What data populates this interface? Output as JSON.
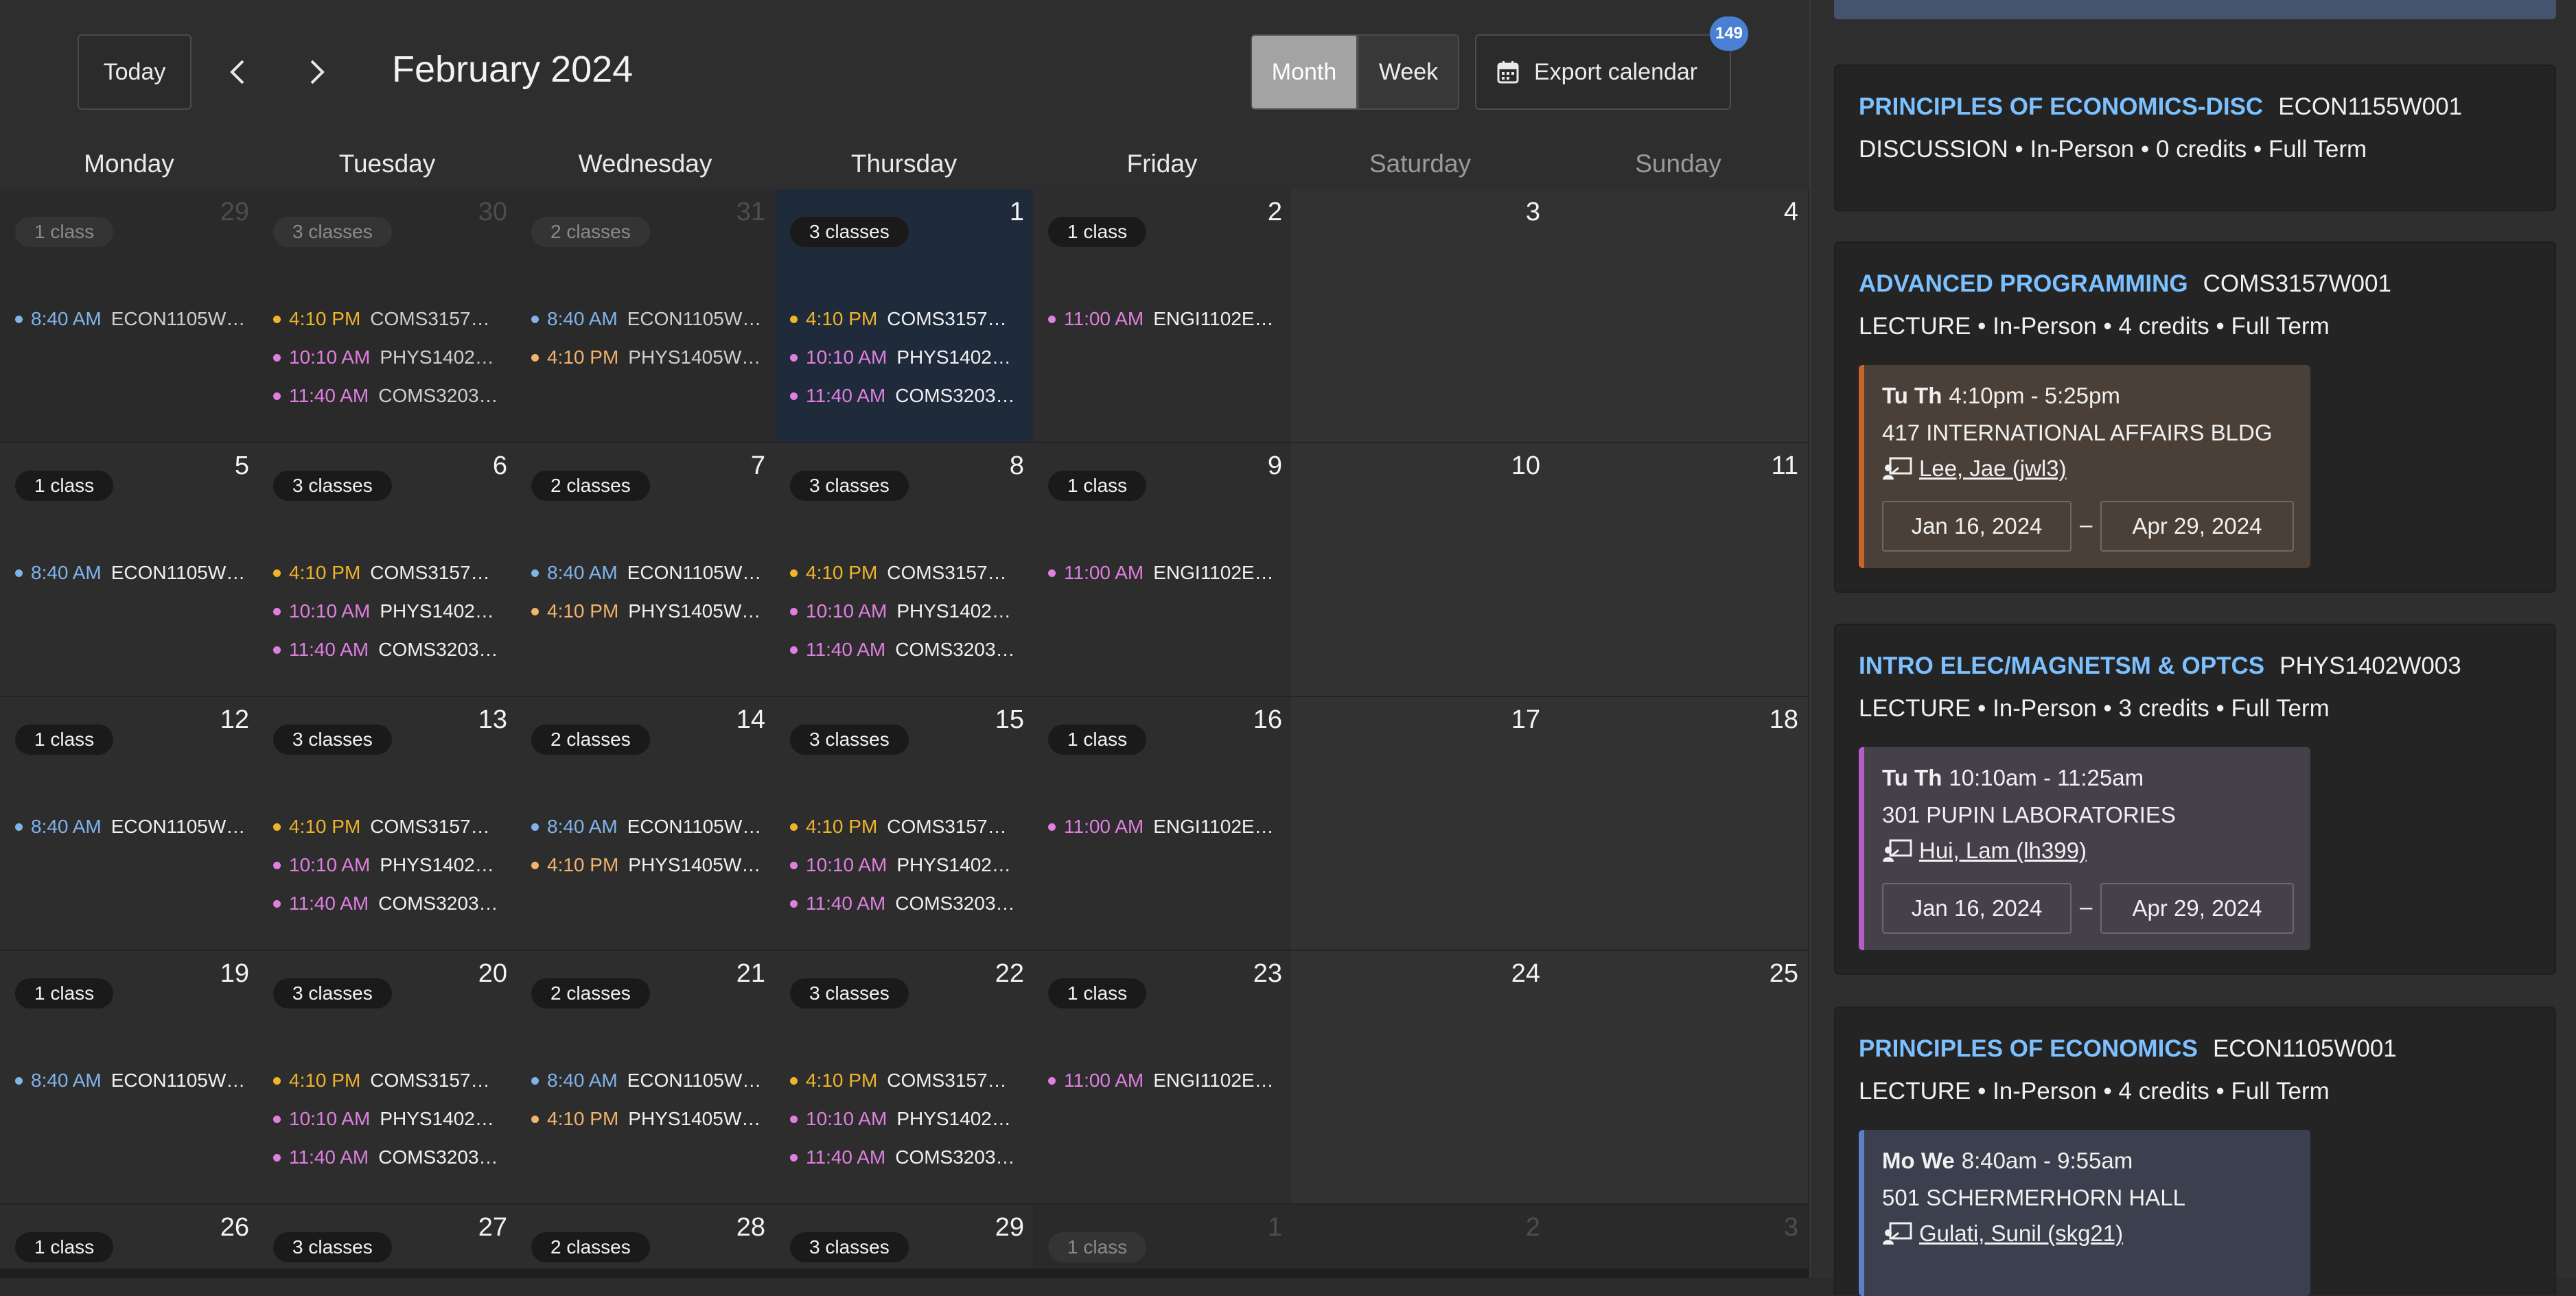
{
  "toolbar": {
    "today_label": "Today",
    "month_title": "February 2024",
    "month_label": "Month",
    "week_label": "Week",
    "export_label": "Export calendar",
    "badge_count": "149"
  },
  "weekdays": [
    "Monday",
    "Tuesday",
    "Wednesday",
    "Thursday",
    "Friday",
    "Saturday",
    "Sunday"
  ],
  "calendar": {
    "weeks": [
      [
        {
          "day": "29",
          "out": true,
          "pill": "1 class",
          "events": [
            {
              "time": "8:40 AM",
              "code": "ECON1105W…",
              "color": "#7fb3ea"
            }
          ]
        },
        {
          "day": "30",
          "out": true,
          "pill": "3 classes",
          "events": [
            {
              "time": "4:10 PM",
              "code": "COMS3157…",
              "color": "#f0b429"
            },
            {
              "time": "10:10 AM",
              "code": "PHYS1402…",
              "color": "#e07fe0"
            },
            {
              "time": "11:40 AM",
              "code": "COMS3203…",
              "color": "#e07fe0"
            }
          ]
        },
        {
          "day": "31",
          "out": true,
          "pill": "2 classes",
          "events": [
            {
              "time": "8:40 AM",
              "code": "ECON1105W…",
              "color": "#7fb3ea"
            },
            {
              "time": "4:10 PM",
              "code": "PHYS1405W…",
              "color": "#f2b36b"
            }
          ]
        },
        {
          "day": "1",
          "today": true,
          "pill": "3 classes",
          "events": [
            {
              "time": "4:10 PM",
              "code": "COMS3157…",
              "color": "#f0b429"
            },
            {
              "time": "10:10 AM",
              "code": "PHYS1402…",
              "color": "#e07fe0"
            },
            {
              "time": "11:40 AM",
              "code": "COMS3203…",
              "color": "#e07fe0"
            }
          ]
        },
        {
          "day": "2",
          "pill": "1 class",
          "events": [
            {
              "time": "11:00 AM",
              "code": "ENGI1102E…",
              "color": "#e07fe0"
            }
          ]
        },
        {
          "day": "3",
          "weekend": true,
          "events": []
        },
        {
          "day": "4",
          "weekend": true,
          "events": []
        }
      ],
      [
        {
          "day": "5",
          "pill": "1 class",
          "events": [
            {
              "time": "8:40 AM",
              "code": "ECON1105W…",
              "color": "#7fb3ea"
            }
          ]
        },
        {
          "day": "6",
          "pill": "3 classes",
          "events": [
            {
              "time": "4:10 PM",
              "code": "COMS3157…",
              "color": "#f0b429"
            },
            {
              "time": "10:10 AM",
              "code": "PHYS1402…",
              "color": "#e07fe0"
            },
            {
              "time": "11:40 AM",
              "code": "COMS3203…",
              "color": "#e07fe0"
            }
          ]
        },
        {
          "day": "7",
          "pill": "2 classes",
          "events": [
            {
              "time": "8:40 AM",
              "code": "ECON1105W…",
              "color": "#7fb3ea"
            },
            {
              "time": "4:10 PM",
              "code": "PHYS1405W…",
              "color": "#f2b36b"
            }
          ]
        },
        {
          "day": "8",
          "pill": "3 classes",
          "events": [
            {
              "time": "4:10 PM",
              "code": "COMS3157…",
              "color": "#f0b429"
            },
            {
              "time": "10:10 AM",
              "code": "PHYS1402…",
              "color": "#e07fe0"
            },
            {
              "time": "11:40 AM",
              "code": "COMS3203…",
              "color": "#e07fe0"
            }
          ]
        },
        {
          "day": "9",
          "pill": "1 class",
          "events": [
            {
              "time": "11:00 AM",
              "code": "ENGI1102E…",
              "color": "#e07fe0"
            }
          ]
        },
        {
          "day": "10",
          "weekend": true,
          "events": []
        },
        {
          "day": "11",
          "weekend": true,
          "events": []
        }
      ],
      [
        {
          "day": "12",
          "pill": "1 class",
          "events": [
            {
              "time": "8:40 AM",
              "code": "ECON1105W…",
              "color": "#7fb3ea"
            }
          ]
        },
        {
          "day": "13",
          "pill": "3 classes",
          "events": [
            {
              "time": "4:10 PM",
              "code": "COMS3157…",
              "color": "#f0b429"
            },
            {
              "time": "10:10 AM",
              "code": "PHYS1402…",
              "color": "#e07fe0"
            },
            {
              "time": "11:40 AM",
              "code": "COMS3203…",
              "color": "#e07fe0"
            }
          ]
        },
        {
          "day": "14",
          "pill": "2 classes",
          "events": [
            {
              "time": "8:40 AM",
              "code": "ECON1105W…",
              "color": "#7fb3ea"
            },
            {
              "time": "4:10 PM",
              "code": "PHYS1405W…",
              "color": "#f2b36b"
            }
          ]
        },
        {
          "day": "15",
          "pill": "3 classes",
          "events": [
            {
              "time": "4:10 PM",
              "code": "COMS3157…",
              "color": "#f0b429"
            },
            {
              "time": "10:10 AM",
              "code": "PHYS1402…",
              "color": "#e07fe0"
            },
            {
              "time": "11:40 AM",
              "code": "COMS3203…",
              "color": "#e07fe0"
            }
          ]
        },
        {
          "day": "16",
          "pill": "1 class",
          "events": [
            {
              "time": "11:00 AM",
              "code": "ENGI1102E…",
              "color": "#e07fe0"
            }
          ]
        },
        {
          "day": "17",
          "weekend": true,
          "events": []
        },
        {
          "day": "18",
          "weekend": true,
          "events": []
        }
      ],
      [
        {
          "day": "19",
          "pill": "1 class",
          "events": [
            {
              "time": "8:40 AM",
              "code": "ECON1105W…",
              "color": "#7fb3ea"
            }
          ]
        },
        {
          "day": "20",
          "pill": "3 classes",
          "events": [
            {
              "time": "4:10 PM",
              "code": "COMS3157…",
              "color": "#f0b429"
            },
            {
              "time": "10:10 AM",
              "code": "PHYS1402…",
              "color": "#e07fe0"
            },
            {
              "time": "11:40 AM",
              "code": "COMS3203…",
              "color": "#e07fe0"
            }
          ]
        },
        {
          "day": "21",
          "pill": "2 classes",
          "events": [
            {
              "time": "8:40 AM",
              "code": "ECON1105W…",
              "color": "#7fb3ea"
            },
            {
              "time": "4:10 PM",
              "code": "PHYS1405W…",
              "color": "#f2b36b"
            }
          ]
        },
        {
          "day": "22",
          "pill": "3 classes",
          "events": [
            {
              "time": "4:10 PM",
              "code": "COMS3157…",
              "color": "#f0b429"
            },
            {
              "time": "10:10 AM",
              "code": "PHYS1402…",
              "color": "#e07fe0"
            },
            {
              "time": "11:40 AM",
              "code": "COMS3203…",
              "color": "#e07fe0"
            }
          ]
        },
        {
          "day": "23",
          "pill": "1 class",
          "events": [
            {
              "time": "11:00 AM",
              "code": "ENGI1102E…",
              "color": "#e07fe0"
            }
          ]
        },
        {
          "day": "24",
          "weekend": true,
          "events": []
        },
        {
          "day": "25",
          "weekend": true,
          "events": []
        }
      ],
      [
        {
          "day": "26",
          "pill": "1 class",
          "events": []
        },
        {
          "day": "27",
          "pill": "3 classes",
          "events": []
        },
        {
          "day": "28",
          "pill": "2 classes",
          "events": []
        },
        {
          "day": "29",
          "pill": "3 classes",
          "events": []
        },
        {
          "day": "1",
          "out": true,
          "pill": "1 class",
          "events": []
        },
        {
          "day": "2",
          "out": true,
          "weekend": true,
          "events": []
        },
        {
          "day": "3",
          "out": true,
          "weekend": true,
          "events": []
        }
      ]
    ]
  },
  "courses": [
    {
      "title": "PRINCIPLES OF ECONOMICS-DISC",
      "code": "ECON1155W001",
      "meta": "DISCUSSION • In-Person • 0 credits • Full Term"
    },
    {
      "title": "ADVANCED PROGRAMMING",
      "code": "COMS3157W001",
      "meta": "LECTURE • In-Person • 4 credits • Full Term",
      "days": "Tu Th",
      "time": "4:10pm - 5:25pm",
      "location": "417 INTERNATIONAL AFFAIRS BLDG",
      "instructor": "Lee, Jae (jwl3)",
      "start": "Jan 16, 2024",
      "end": "Apr 29, 2024",
      "accent": "#c8642a",
      "sched_bg": "#4a4038"
    },
    {
      "title": "INTRO ELEC/MAGNETSM & OPTCS",
      "code": "PHYS1402W003",
      "meta": "LECTURE • In-Person • 3 credits • Full Term",
      "days": "Tu Th",
      "time": "10:10am - 11:25am",
      "location": "301 PUPIN LABORATORIES",
      "instructor": "Hui, Lam (lh399)",
      "start": "Jan 16, 2024",
      "end": "Apr 29, 2024",
      "accent": "#b45cc8",
      "sched_bg": "#45404a"
    },
    {
      "title": "PRINCIPLES OF ECONOMICS",
      "code": "ECON1105W001",
      "meta": "LECTURE • In-Person • 4 credits • Full Term",
      "days": "Mo We",
      "time": "8:40am - 9:55am",
      "location": "501 SCHERMERHORN HALL",
      "instructor": "Gulati, Sunil (skg21)",
      "accent": "#5b7fc8",
      "sched_bg": "#3c404e"
    }
  ],
  "date_separator": "–",
  "colors": {
    "accent_link": "#7cc0ff",
    "today_bg": "#1f2a3b",
    "badge": "#4a7fd6"
  }
}
